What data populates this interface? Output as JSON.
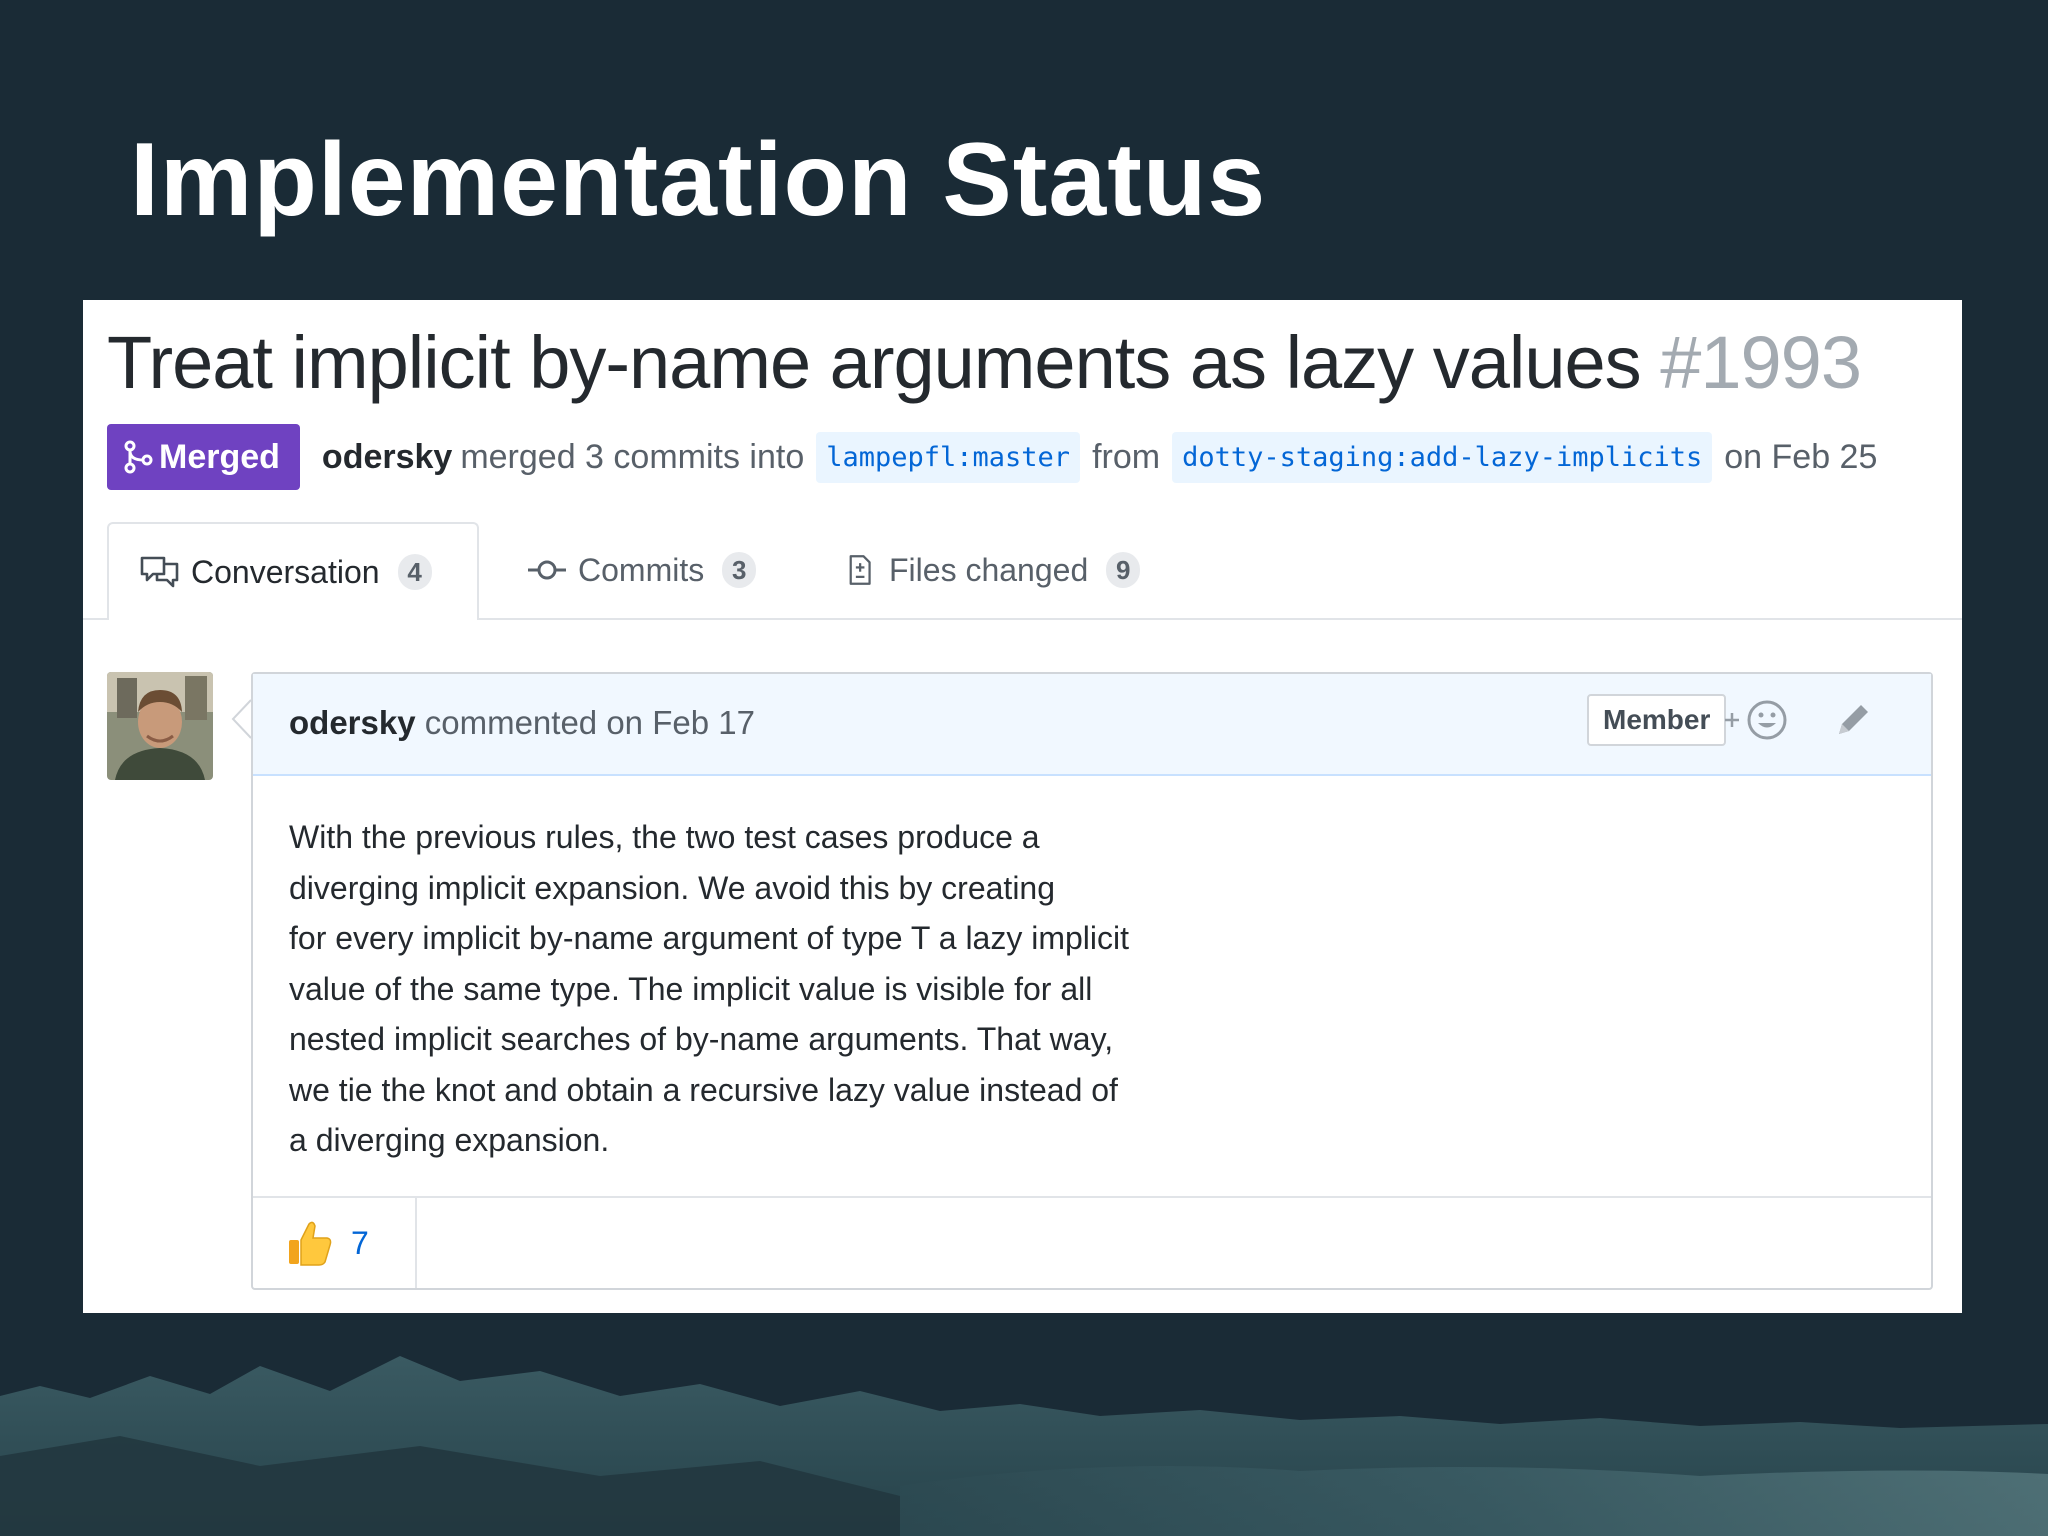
{
  "slide": {
    "title": "Implementation Status"
  },
  "pull_request": {
    "title": "Treat implicit by-name arguments as lazy values",
    "number": "#1993",
    "state_label": "Merged",
    "author": "odersky",
    "merged_text": "merged 3 commits into",
    "base_branch": "lampepfl:master",
    "from_text": "from",
    "head_branch": "dotty-staging:add-lazy-implicits",
    "date_text": "on Feb 25"
  },
  "tabs": [
    {
      "label": "Conversation",
      "count": "4",
      "icon": "comment-discussion-icon"
    },
    {
      "label": "Commits",
      "count": "3",
      "icon": "git-commit-icon"
    },
    {
      "label": "Files changed",
      "count": "9",
      "icon": "file-diff-icon"
    }
  ],
  "comment": {
    "author": "odersky",
    "action": "commented on Feb 17",
    "role_badge": "Member",
    "body_lines": [
      "With the previous rules, the two test cases produce a",
      "diverging implicit expansion. We avoid this by creating",
      "for every implicit by-name argument of type T a lazy implicit",
      "value of the same type. The implicit value is visible for all",
      "nested implicit searches of by-name arguments. That way,",
      "we tie the knot and obtain a recursive lazy value instead of",
      "a diverging expansion."
    ],
    "reactions": [
      {
        "emoji": "thumbs-up-icon",
        "count": "7"
      }
    ]
  },
  "colors": {
    "slide_background": "#1a2b36",
    "merged_badge": "#6f42c1",
    "link_blue": "#0366d6",
    "comment_header": "#f1f8ff"
  }
}
